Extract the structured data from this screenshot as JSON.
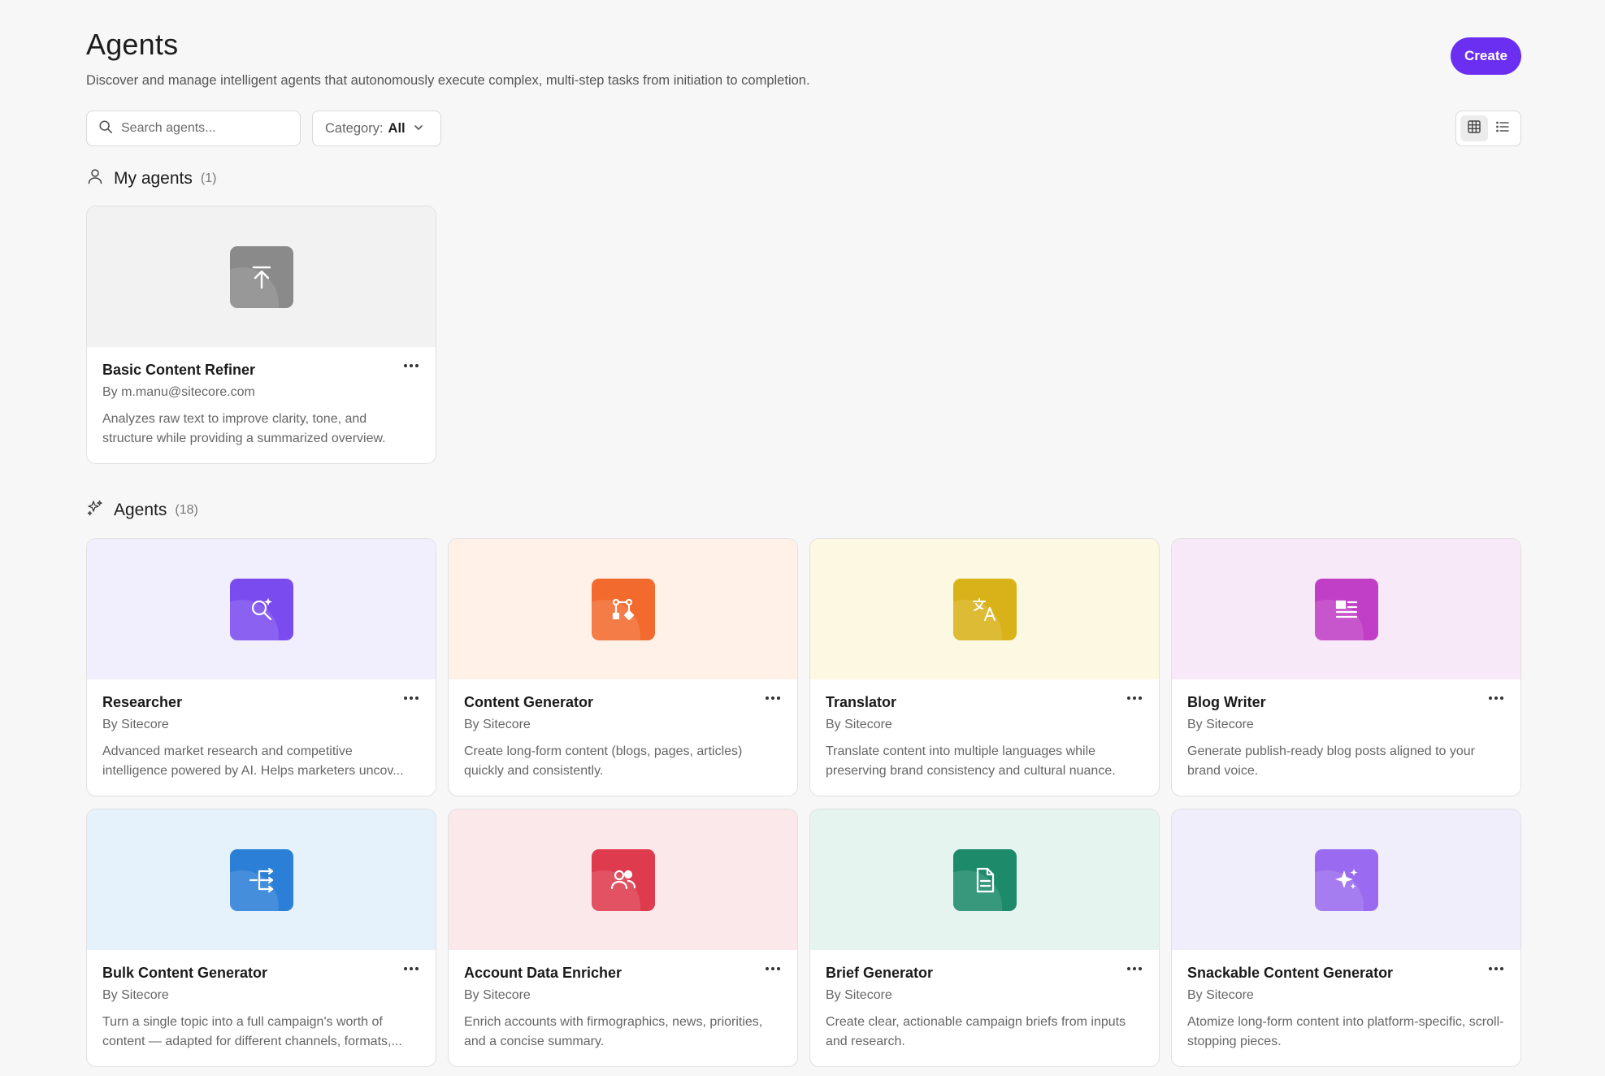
{
  "header": {
    "title": "Agents",
    "subtitle": "Discover and manage intelligent agents that autonomously execute complex, multi-step tasks from initiation to completion.",
    "create_label": "Create",
    "accent": "#6b2ff2"
  },
  "toolbar": {
    "search_placeholder": "Search agents...",
    "category_label": "Category:",
    "category_value": "All",
    "view_modes": [
      "grid",
      "list"
    ],
    "active_view": "grid"
  },
  "my_agents": {
    "title": "My agents",
    "count": "(1)",
    "items": [
      {
        "title": "Basic Content Refiner",
        "author": "By m.manu@sitecore.com",
        "description": "Analyzes raw text to improve clarity, tone, and structure while providing a summarized overview.",
        "icon": "upload-icon",
        "bg": "#f2f2f2",
        "icon_bg": "#8a8a8a"
      }
    ]
  },
  "agents": {
    "title": "Agents",
    "count": "(18)",
    "items": [
      {
        "title": "Researcher",
        "author": "By Sitecore",
        "description": "Advanced market research and competitive intelligence powered by AI. Helps marketers uncov...",
        "icon": "search-sparkle-icon",
        "bg": "#f1effd",
        "icon_bg": "#7a4cf0"
      },
      {
        "title": "Content Generator",
        "author": "By Sitecore",
        "description": "Create long-form content (blogs, pages, articles) quickly and consistently.",
        "icon": "workflow-icon",
        "bg": "#fff1e8",
        "icon_bg": "#f26a2e"
      },
      {
        "title": "Translator",
        "author": "By Sitecore",
        "description": "Translate content into multiple languages while preserving brand consistency and cultural nuance.",
        "icon": "translate-icon",
        "bg": "#fdf8e1",
        "icon_bg": "#d9b21a"
      },
      {
        "title": "Blog Writer",
        "author": "By Sitecore",
        "description": "Generate publish-ready blog posts aligned to your brand voice.",
        "icon": "article-icon",
        "bg": "#f8e9f8",
        "icon_bg": "#c03fc6"
      },
      {
        "title": "Bulk Content Generator",
        "author": "By Sitecore",
        "description": "Turn a single topic into a full campaign's worth of content — adapted for different channels, formats,...",
        "icon": "branch-icon",
        "bg": "#e6f2fb",
        "icon_bg": "#2b7fd6"
      },
      {
        "title": "Account Data Enricher",
        "author": "By Sitecore",
        "description": "Enrich accounts with firmographics, news, priorities, and a concise summary.",
        "icon": "users-icon",
        "bg": "#fbe8ea",
        "icon_bg": "#de3b4e"
      },
      {
        "title": "Brief Generator",
        "author": "By Sitecore",
        "description": "Create clear, actionable campaign briefs from inputs and research.",
        "icon": "document-icon",
        "bg": "#e6f4ef",
        "icon_bg": "#1d8a6a"
      },
      {
        "title": "Snackable Content Generator",
        "author": "By Sitecore",
        "description": "Atomize long-form content into platform-specific, scroll-stopping pieces.",
        "icon": "sparkles-icon",
        "bg": "#f1eefc",
        "icon_bg": "#9a6bf0"
      }
    ]
  }
}
